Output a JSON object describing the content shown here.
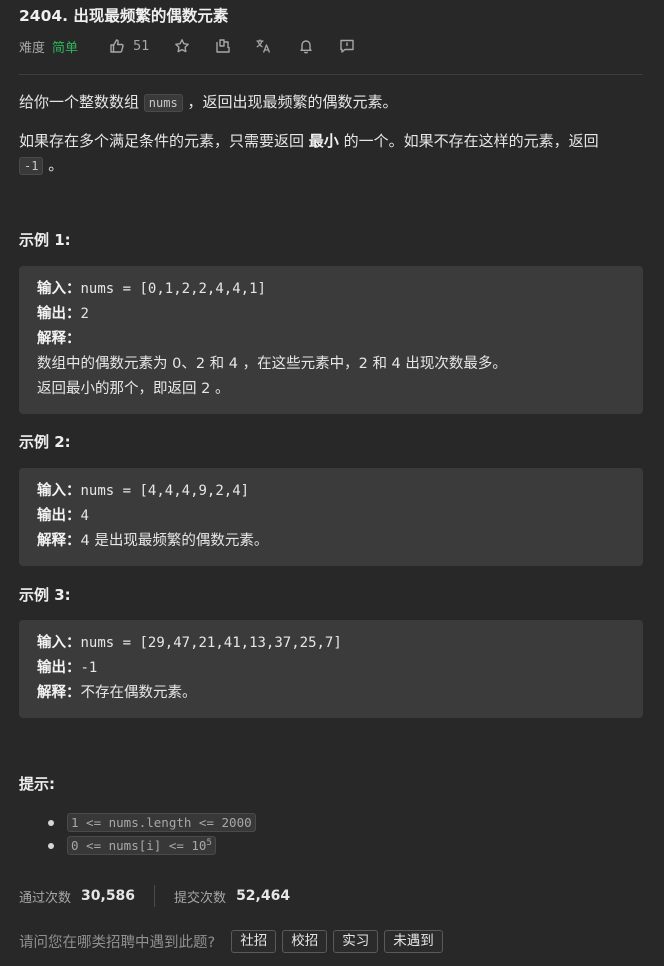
{
  "problem": {
    "title": "2404. 出现最频繁的偶数元素",
    "difficulty_label": "难度",
    "difficulty_value": "简单",
    "likes": "51"
  },
  "description": {
    "p1_before": "给你一个整数数组 ",
    "p1_code": "nums",
    "p1_after": " ，返回出现最频繁的偶数元素。",
    "p2_before": "如果存在多个满足条件的元素，只需要返回 ",
    "p2_bold": "最小",
    "p2_after": " 的一个。如果不存在这样的元素，返回 ",
    "p2_code": "-1",
    "p2_end": " 。"
  },
  "examples": [
    {
      "title": "示例 1:",
      "input_label": "输入：",
      "input_value": "nums = [0,1,2,2,4,4,1]",
      "output_label": "输出：",
      "output_value": "2",
      "explain_label": "解释：",
      "explain_line1": "数组中的偶数元素为 0、2 和 4 ，在这些元素中，2 和 4 出现次数最多。",
      "explain_line2": "返回最小的那个，即返回 2 。"
    },
    {
      "title": "示例 2:",
      "input_label": "输入：",
      "input_value": "nums = [4,4,4,9,2,4]",
      "output_label": "输出：",
      "output_value": "4",
      "explain_label": "解释：",
      "explain_line1": "4 是出现最频繁的偶数元素。"
    },
    {
      "title": "示例 3:",
      "input_label": "输入：",
      "input_value": "nums = [29,47,21,41,13,37,25,7]",
      "output_label": "输出：",
      "output_value": "-1",
      "explain_label": "解释：",
      "explain_line1": "不存在偶数元素。"
    }
  ],
  "hints": {
    "title": "提示:",
    "items": [
      {
        "text": "1 <= nums.length <= 2000"
      },
      {
        "text": "0 <= nums[i] <= 10",
        "sup": "5"
      }
    ]
  },
  "stats": {
    "accepted_label": "通过次数",
    "accepted_value": "30,586",
    "submitted_label": "提交次数",
    "submitted_value": "52,464"
  },
  "survey": {
    "question": "请问您在哪类招聘中遇到此题?",
    "options": [
      "社招",
      "校招",
      "实习",
      "未遇到"
    ]
  },
  "icons": [
    "thumbs-up-icon",
    "star-icon",
    "share-icon",
    "translate-icon",
    "bell-icon",
    "feedback-icon"
  ],
  "colors": {
    "background": "#282828",
    "easy": "#2db55d",
    "example_box": "#3b3b3b"
  }
}
